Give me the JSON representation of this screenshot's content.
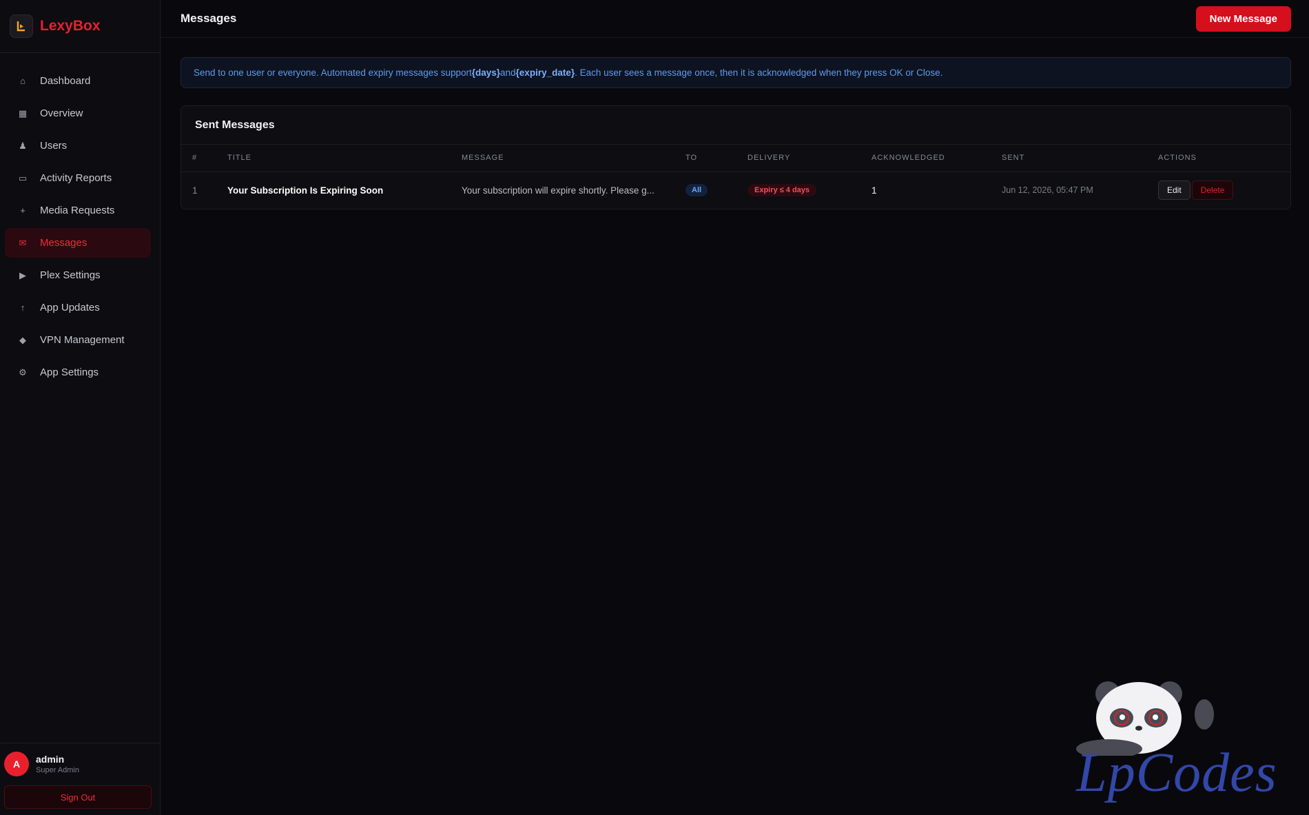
{
  "brand": {
    "name": "LexyBox"
  },
  "sidebar": {
    "items": [
      {
        "label": "Dashboard",
        "icon": "home-icon",
        "glyph": "⌂"
      },
      {
        "label": "Overview",
        "icon": "grid-icon",
        "glyph": "▦"
      },
      {
        "label": "Users",
        "icon": "user-icon",
        "glyph": "♟"
      },
      {
        "label": "Activity Reports",
        "icon": "monitor-icon",
        "glyph": "▭"
      },
      {
        "label": "Media Requests",
        "icon": "plus-icon",
        "glyph": "+"
      },
      {
        "label": "Messages",
        "icon": "mail-icon",
        "glyph": "✉"
      },
      {
        "label": "Plex Settings",
        "icon": "play-icon",
        "glyph": "▶"
      },
      {
        "label": "App Updates",
        "icon": "arrow-up-icon",
        "glyph": "↑"
      },
      {
        "label": "VPN Management",
        "icon": "diamond-icon",
        "glyph": "◆"
      },
      {
        "label": "App Settings",
        "icon": "gear-icon",
        "glyph": "⚙"
      }
    ],
    "active_index": 5
  },
  "user": {
    "initial": "A",
    "name": "admin",
    "role": "Super Admin",
    "signout_label": "Sign Out"
  },
  "header": {
    "title": "Messages",
    "new_button_label": "New Message"
  },
  "info_banner": {
    "part1": "Send to one user or everyone. Automated expiry messages support ",
    "token_days": "{days}",
    "part2": " and ",
    "token_expiry": "{expiry_date}",
    "part3": ". Each user sees a message once, then it is acknowledged when they press OK or Close."
  },
  "sent_messages": {
    "title": "Sent Messages",
    "columns": [
      "#",
      "TITLE",
      "MESSAGE",
      "TO",
      "DELIVERY",
      "ACKNOWLEDGED",
      "SENT",
      "ACTIONS"
    ],
    "rows": [
      {
        "num": "1",
        "title": "Your Subscription Is Expiring Soon",
        "message": "Your subscription will expire shortly. Please g...",
        "to": "All",
        "delivery": "Expiry ≤ 4 days",
        "acknowledged": "1",
        "sent": "Jun 12, 2026, 05:47 PM",
        "edit_label": "Edit",
        "delete_label": "Delete"
      }
    ]
  },
  "watermark": {
    "text": "LpCodes"
  },
  "colors": {
    "accent": "#e8202e",
    "info": "#5e9cf2",
    "background": "#09090d"
  }
}
